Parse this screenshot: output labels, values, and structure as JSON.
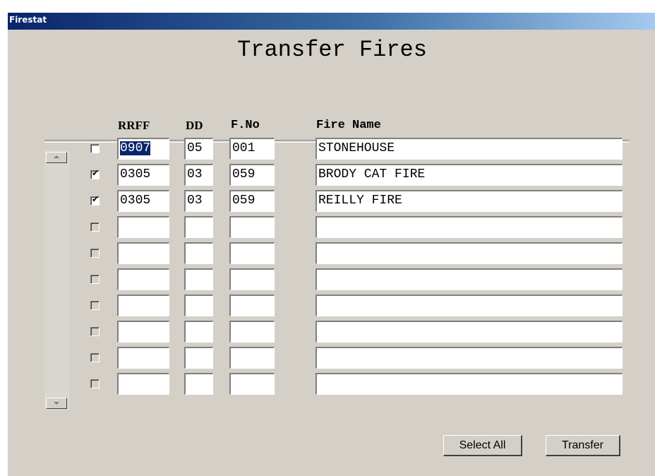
{
  "window": {
    "title": "Firestat"
  },
  "page": {
    "title": "Transfer Fires"
  },
  "columns": {
    "rrff": "RRFF",
    "dd": "DD",
    "fno": "F.No",
    "fire_name": "Fire Name"
  },
  "rows": [
    {
      "checked": false,
      "enabled": true,
      "rrff": "0907",
      "dd": "05",
      "fno": "001",
      "fire_name": "STONEHOUSE"
    },
    {
      "checked": true,
      "enabled": true,
      "rrff": "0305",
      "dd": "03",
      "fno": "059",
      "fire_name": "BRODY CAT FIRE"
    },
    {
      "checked": true,
      "enabled": true,
      "rrff": "0305",
      "dd": "03",
      "fno": "059",
      "fire_name": "REILLY FIRE"
    },
    {
      "checked": false,
      "enabled": false,
      "rrff": "",
      "dd": "",
      "fno": "",
      "fire_name": ""
    },
    {
      "checked": false,
      "enabled": false,
      "rrff": "",
      "dd": "",
      "fno": "",
      "fire_name": ""
    },
    {
      "checked": false,
      "enabled": false,
      "rrff": "",
      "dd": "",
      "fno": "",
      "fire_name": ""
    },
    {
      "checked": false,
      "enabled": false,
      "rrff": "",
      "dd": "",
      "fno": "",
      "fire_name": ""
    },
    {
      "checked": false,
      "enabled": false,
      "rrff": "",
      "dd": "",
      "fno": "",
      "fire_name": ""
    },
    {
      "checked": false,
      "enabled": false,
      "rrff": "",
      "dd": "",
      "fno": "",
      "fire_name": ""
    },
    {
      "checked": false,
      "enabled": false,
      "rrff": "",
      "dd": "",
      "fno": "",
      "fire_name": ""
    }
  ],
  "selected_field": "rrff-0",
  "buttons": {
    "select_all": "Select All",
    "transfer": "Transfer"
  },
  "icons": {
    "scroll_up": "scroll-up-arrow-icon",
    "scroll_down": "scroll-down-arrow-icon",
    "check": "checkmark-icon"
  },
  "colors": {
    "title_gradient_start": "#0a246a",
    "title_gradient_end": "#a6caf0",
    "face": "#d4d0c8",
    "selection": "#0a246a"
  }
}
